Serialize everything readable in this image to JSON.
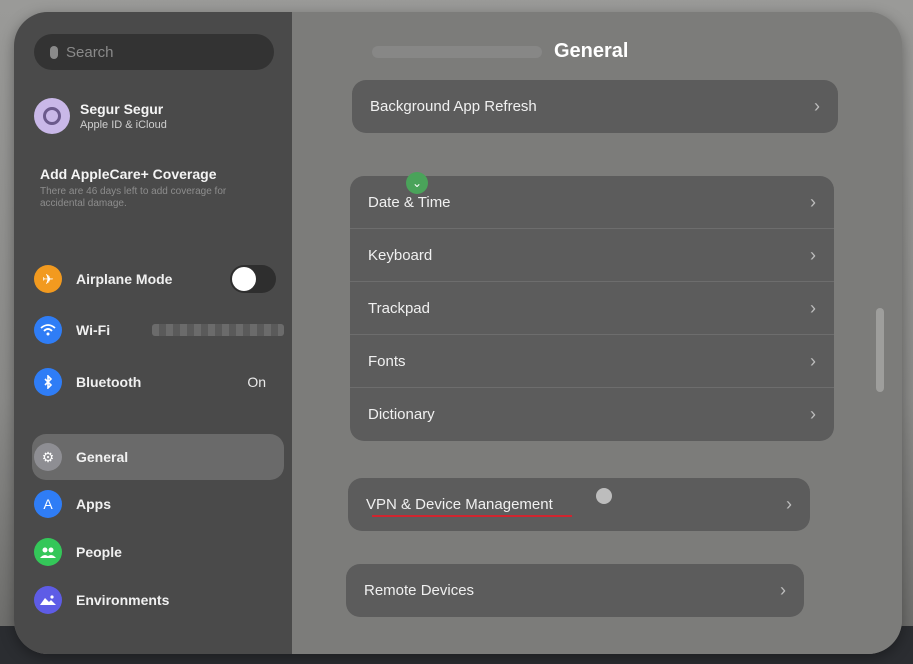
{
  "search": {
    "placeholder": "Search"
  },
  "profile": {
    "name": "Segur Segur",
    "subtitle": "Apple ID & iCloud"
  },
  "applecare": {
    "title": "Add AppleCare+ Coverage",
    "subtitle": "There are 46 days left to add coverage for accidental damage."
  },
  "sidebar": {
    "items": [
      {
        "label": "Airplane Mode",
        "icon": "airplane-icon",
        "color": "#f29a1f",
        "toggle": false
      },
      {
        "label": "Wi-Fi",
        "icon": "wifi-icon",
        "color": "#2f7df6"
      },
      {
        "label": "Bluetooth",
        "icon": "bluetooth-icon",
        "color": "#2f7df6",
        "value": "On"
      },
      {
        "label": "General",
        "icon": "gear-icon",
        "color": "#8e8e93",
        "selected": true
      },
      {
        "label": "Apps",
        "icon": "apps-icon",
        "color": "#2f7df6"
      },
      {
        "label": "People",
        "icon": "people-icon",
        "color": "#34c759"
      },
      {
        "label": "Environments",
        "icon": "environments-icon",
        "color": "#5e5ce6"
      }
    ]
  },
  "header": {
    "title": "General"
  },
  "groups": {
    "top": [
      "Background App Refresh"
    ],
    "middle": [
      "Date & Time",
      "Keyboard",
      "Trackpad",
      "Fonts",
      "Dictionary"
    ],
    "vpn": [
      "VPN & Device Management"
    ],
    "remote": [
      "Remote Devices"
    ]
  },
  "chevron": "›"
}
